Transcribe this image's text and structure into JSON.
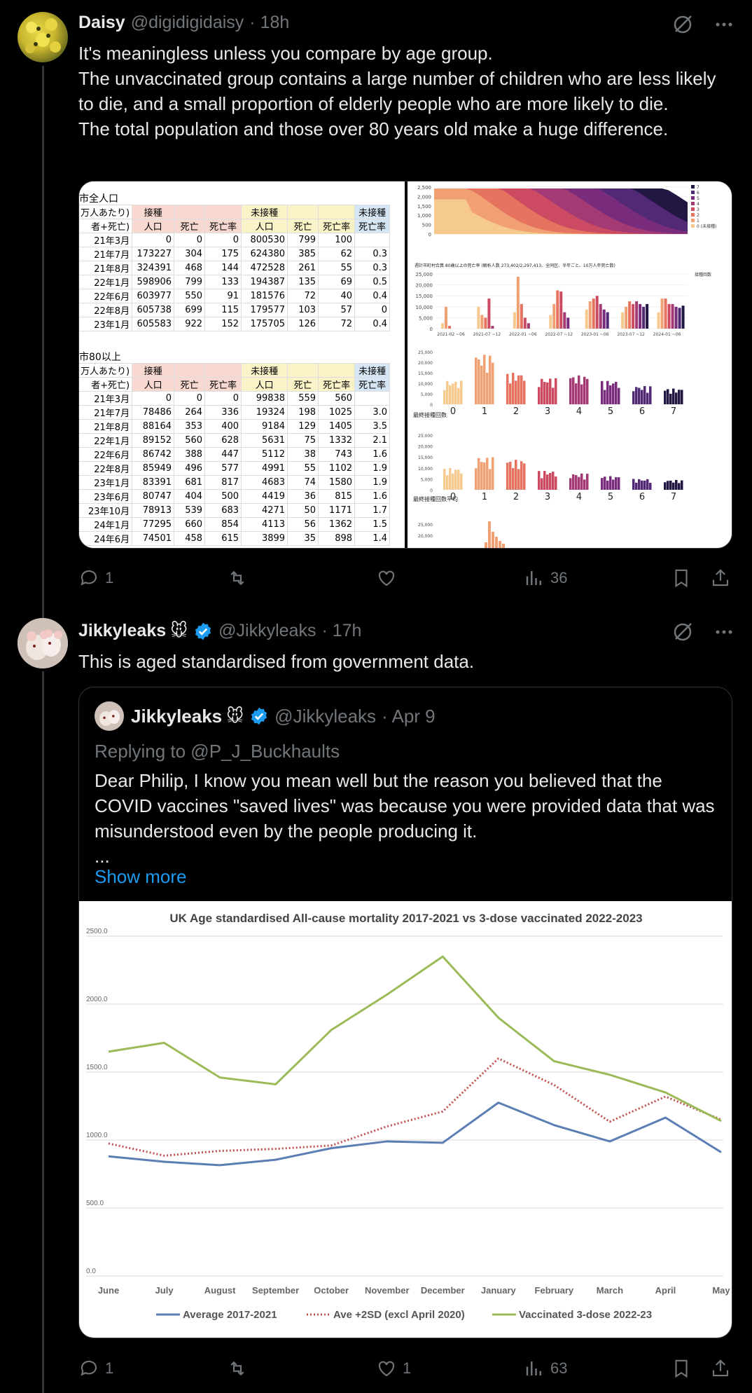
{
  "post1": {
    "name": "Daisy",
    "handle": "@digidigidaisy",
    "time": "· 18h",
    "text": [
      "It's meaningless unless you compare by age group.",
      "The unvaccinated group contains a large number of children who are less likely to die, and a small proportion of elderly people who are more likely to die.",
      "The total population and those over 80 years old make a huge difference."
    ],
    "table1": {
      "title": "市全人口",
      "header1": [
        "万人あたり)",
        "接種",
        "",
        "",
        "未接種",
        "",
        "",
        "未接種"
      ],
      "header2": [
        "者+死亡)",
        "人口",
        "死亡",
        "死亡率",
        "人口",
        "死亡",
        "死亡率",
        "死亡率"
      ],
      "rows": [
        [
          "21年3月",
          "0",
          "0",
          "0",
          "800530",
          "799",
          "100",
          ""
        ],
        [
          "21年7月",
          "173227",
          "304",
          "175",
          "624380",
          "385",
          "62",
          "0.3"
        ],
        [
          "21年8月",
          "324391",
          "468",
          "144",
          "472528",
          "261",
          "55",
          "0.3"
        ],
        [
          "22年1月",
          "598906",
          "799",
          "133",
          "194387",
          "135",
          "69",
          "0.5"
        ],
        [
          "22年6月",
          "603977",
          "550",
          "91",
          "181576",
          "72",
          "40",
          "0.4"
        ],
        [
          "22年8月",
          "605738",
          "699",
          "115",
          "179577",
          "103",
          "57",
          "0"
        ],
        [
          "23年1月",
          "605583",
          "922",
          "152",
          "175705",
          "126",
          "72",
          "0.4"
        ]
      ]
    },
    "table2": {
      "title": "市80以上",
      "header1": [
        "万人あたり)",
        "接種",
        "",
        "",
        "未接種",
        "",
        "",
        "未接種"
      ],
      "header2": [
        "者+死亡)",
        "人口",
        "死亡",
        "死亡率",
        "人口",
        "死亡",
        "死亡率",
        "死亡率"
      ],
      "rows": [
        [
          "21年3月",
          "0",
          "0",
          "0",
          "99838",
          "559",
          "560",
          ""
        ],
        [
          "21年7月",
          "78486",
          "264",
          "336",
          "19324",
          "198",
          "1025",
          "3.0"
        ],
        [
          "21年8月",
          "88164",
          "353",
          "400",
          "9184",
          "129",
          "1405",
          "3.5"
        ],
        [
          "22年1月",
          "89152",
          "560",
          "628",
          "5631",
          "75",
          "1332",
          "2.1"
        ],
        [
          "22年6月",
          "86742",
          "388",
          "447",
          "5112",
          "38",
          "743",
          "1.6"
        ],
        [
          "22年8月",
          "85949",
          "496",
          "577",
          "4991",
          "55",
          "1102",
          "1.9"
        ],
        [
          "23年1月",
          "83391",
          "681",
          "817",
          "4683",
          "74",
          "1580",
          "1.9"
        ],
        [
          "23年6月",
          "80747",
          "404",
          "500",
          "4419",
          "36",
          "815",
          "1.6"
        ],
        [
          "23年10月",
          "78913",
          "539",
          "683",
          "4271",
          "50",
          "1171",
          "1.7"
        ],
        [
          "24年1月",
          "77295",
          "660",
          "854",
          "4113",
          "56",
          "1362",
          "1.5"
        ],
        [
          "24年6月",
          "74501",
          "458",
          "615",
          "3899",
          "35",
          "898",
          "1.4"
        ]
      ]
    },
    "right_panel": {
      "area_yticks": [
        "2,500",
        "2,000",
        "1,500",
        "1,000",
        "500",
        "0"
      ],
      "bar_title": "週計市町村合算 80歳以上の死亡率 (解析人数 273,402/2,297,413、全同区、半年ごと、10万人年死亡数)",
      "bar_xticks": [
        "2021-02 ~06",
        "2021-07 ~12",
        "2022-01 ~06",
        "2022-07 ~12",
        "2023-01 ~06",
        "2023-07 ~12",
        "2024-01 ~06"
      ],
      "legend_title": "接種回数",
      "legend": [
        "7",
        "6",
        "5",
        "4",
        "3",
        "2",
        "1",
        "0 (未接種)"
      ],
      "dose_label": "最終接種回数",
      "dose_label2": "最終接種回数平均",
      "dose_ticks": [
        "0",
        "1",
        "2",
        "3",
        "4",
        "5",
        "6",
        "7"
      ],
      "small_yticks": [
        "25,000",
        "20,000",
        "15,000",
        "10,000",
        "5,000",
        "0"
      ]
    },
    "actions": {
      "replies": "1",
      "retweets": "",
      "likes": "",
      "views": "36"
    }
  },
  "post2": {
    "name": "Jikkyleaks",
    "emoji": "🐭",
    "handle": "@Jikkyleaks",
    "time": "· 17h",
    "text": "This is aged standardised from government data.",
    "quote": {
      "name": "Jikkyleaks",
      "emoji": "🐭",
      "handle": "@Jikkyleaks",
      "time": "· Apr 9",
      "reply": "Replying to @P_J_Buckhaults",
      "text": "Dear Philip, I know you mean well but the reason you believed that the COVID vaccines \"saved lives\" was because you were provided data that was misunderstood even by the people producing it.",
      "ellipsis": "...",
      "show_more": "Show more"
    },
    "actions": {
      "replies": "1",
      "retweets": "",
      "likes": "1",
      "views": "63"
    }
  },
  "chart_data": {
    "type": "line",
    "title": "UK Age standardised All-cause mortality 2017-2021 vs 3-dose vaccinated 2022-2023",
    "categories": [
      "June",
      "July",
      "August",
      "September",
      "October",
      "November",
      "December",
      "January",
      "February",
      "March",
      "April",
      "May"
    ],
    "ylim": [
      0,
      2500
    ],
    "yticks": [
      "0.0",
      "500.0",
      "1000.0",
      "1500.0",
      "2000.0",
      "2500.0"
    ],
    "grid": true,
    "legend_position": "bottom",
    "series": [
      {
        "name": "Average 2017-2021",
        "color": "#5b7fb5",
        "style": "solid",
        "values": [
          880,
          840,
          815,
          855,
          940,
          990,
          980,
          1275,
          1110,
          990,
          1165,
          910
        ]
      },
      {
        "name": "Ave +2SD (excl April 2020)",
        "color": "#c0504d",
        "style": "dotted",
        "values": [
          975,
          885,
          920,
          935,
          960,
          1100,
          1210,
          1600,
          1405,
          1135,
          1320,
          1150
        ]
      },
      {
        "name": "Vaccinated 3-dose 2022-23",
        "color": "#9bbb59",
        "style": "solid",
        "values": [
          1650,
          1715,
          1460,
          1410,
          1810,
          2070,
          2350,
          1900,
          1580,
          1480,
          1350,
          1140
        ]
      }
    ]
  }
}
